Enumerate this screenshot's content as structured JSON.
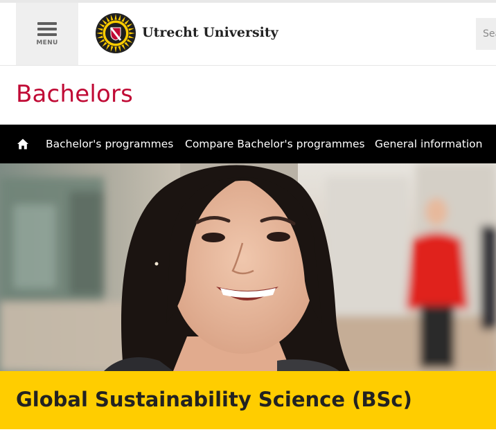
{
  "header": {
    "menu_label": "MENU",
    "logo_text": "Utrecht University",
    "search_placeholder": "Search"
  },
  "section": {
    "title": "Bachelors"
  },
  "nav": {
    "home_icon": "home-icon",
    "items": [
      {
        "label": "Bachelor's programmes"
      },
      {
        "label": "Compare Bachelor's programmes"
      },
      {
        "label": "General information"
      }
    ]
  },
  "hero": {
    "description": "photo-of-smiling-student"
  },
  "programme": {
    "title": "Global Sustainability Science (BSc)"
  },
  "colors": {
    "brand_red": "#c00a35",
    "brand_yellow": "#ffcd00",
    "nav_bg": "#000000"
  }
}
